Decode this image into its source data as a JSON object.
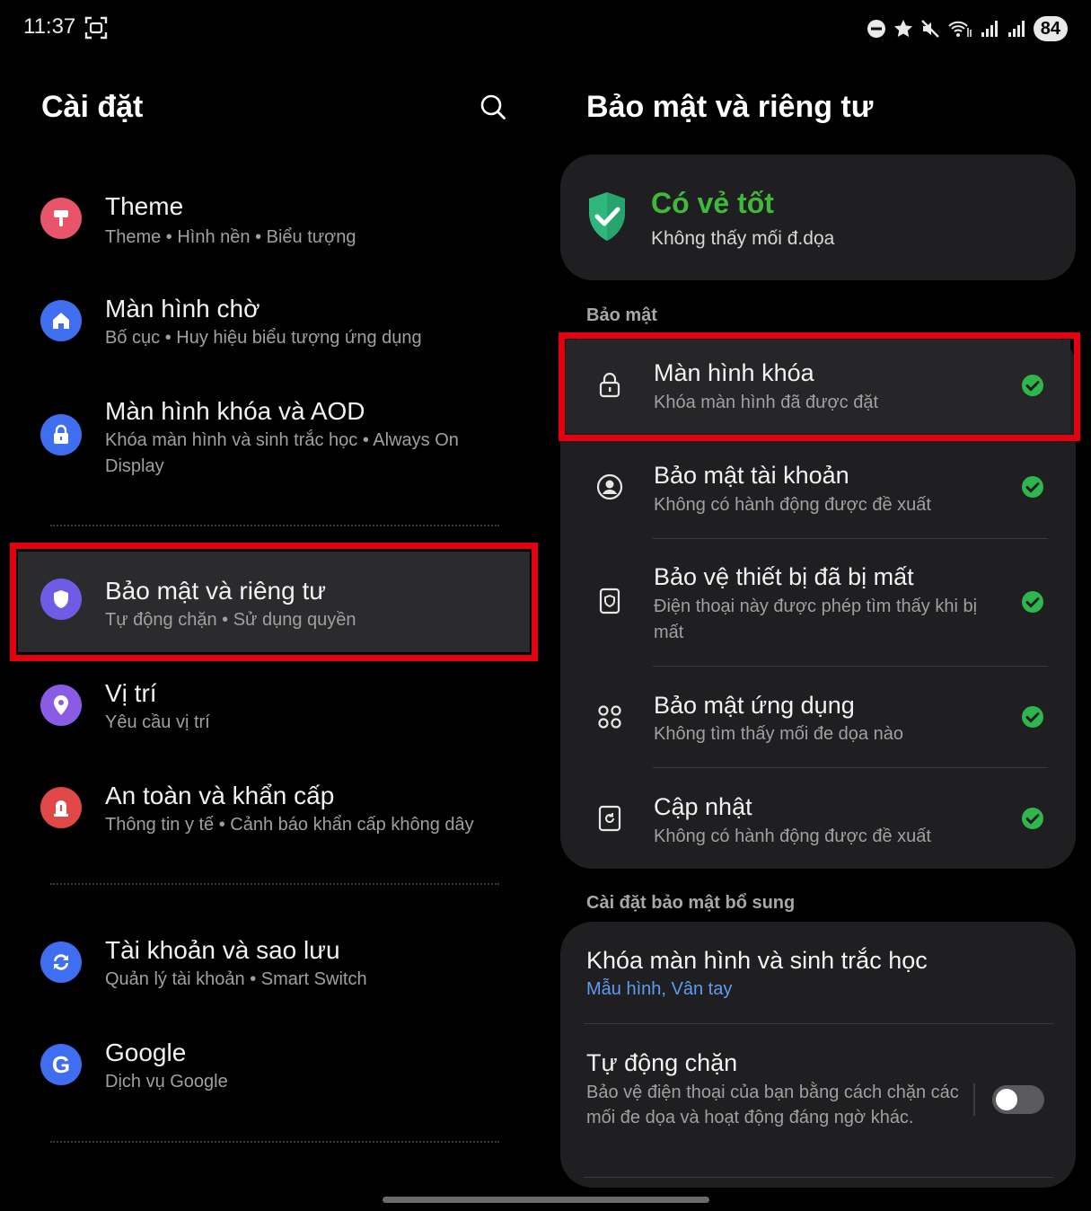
{
  "status_bar": {
    "time": "11:37",
    "battery": "84"
  },
  "left": {
    "title": "Cài đặt",
    "items": [
      {
        "title": "Theme",
        "subtitle": "Theme  •  Hình nền  •  Biểu tượng",
        "color": "#e8546a"
      },
      {
        "title": "Màn hình chờ",
        "subtitle": "Bố cục  •  Huy hiệu biểu tượng ứng dụng",
        "color": "#3f6ff0"
      },
      {
        "title": "Màn hình khóa và AOD",
        "subtitle": "Khóa màn hình và sinh trắc học  •  Always On Display",
        "color": "#3f6ff0"
      },
      {
        "title": "Bảo mật và riêng tư",
        "subtitle": "Tự động chặn  •  Sử dụng quyền",
        "color": "#6e5ce6"
      },
      {
        "title": "Vị trí",
        "subtitle": "Yêu cầu vị trí",
        "color": "#8a5ce6"
      },
      {
        "title": "An toàn và khẩn cấp",
        "subtitle": "Thông tin y tế  •  Cảnh báo khẩn cấp không dây",
        "color": "#e04848"
      },
      {
        "title": "Tài khoản và sao lưu",
        "subtitle": "Quản lý tài khoản  •  Smart Switch",
        "color": "#3f6ff0"
      },
      {
        "title": "Google",
        "subtitle": "Dịch vụ Google",
        "color": "#3f6ff0"
      }
    ]
  },
  "right": {
    "title": "Bảo mật và riêng tư",
    "status": {
      "headline": "Có vẻ tốt",
      "detail": "Không thấy mối đ.dọa"
    },
    "security_label": "Bảo mật",
    "security_items": [
      {
        "title": "Màn hình khóa",
        "subtitle": "Khóa màn hình đã được đặt"
      },
      {
        "title": "Bảo mật tài khoản",
        "subtitle": "Không có hành động được đề xuất"
      },
      {
        "title": "Bảo vệ thiết bị đã bị mất",
        "subtitle": "Điện thoại này được phép tìm thấy khi bị mất"
      },
      {
        "title": "Bảo mật ứng dụng",
        "subtitle": "Không tìm thấy mối đe dọa nào"
      },
      {
        "title": "Cập nhật",
        "subtitle": "Không có hành động được đề xuất"
      }
    ],
    "extra_label": "Cài đặt bảo mật bổ sung",
    "extra_items": [
      {
        "title": "Khóa màn hình và sinh trắc học",
        "subtitle": "Mẫu hình, Vân tay"
      },
      {
        "title": "Tự động chặn",
        "subtitle": "Bảo vệ điện thoại của bạn bằng cách chặn các mối đe dọa và hoạt động đáng ngờ khác.",
        "toggle_on": false
      }
    ]
  },
  "colors": {
    "accent_green": "#3fb83c",
    "highlight_red": "#e3000f",
    "link_blue": "#5f9cf0"
  }
}
